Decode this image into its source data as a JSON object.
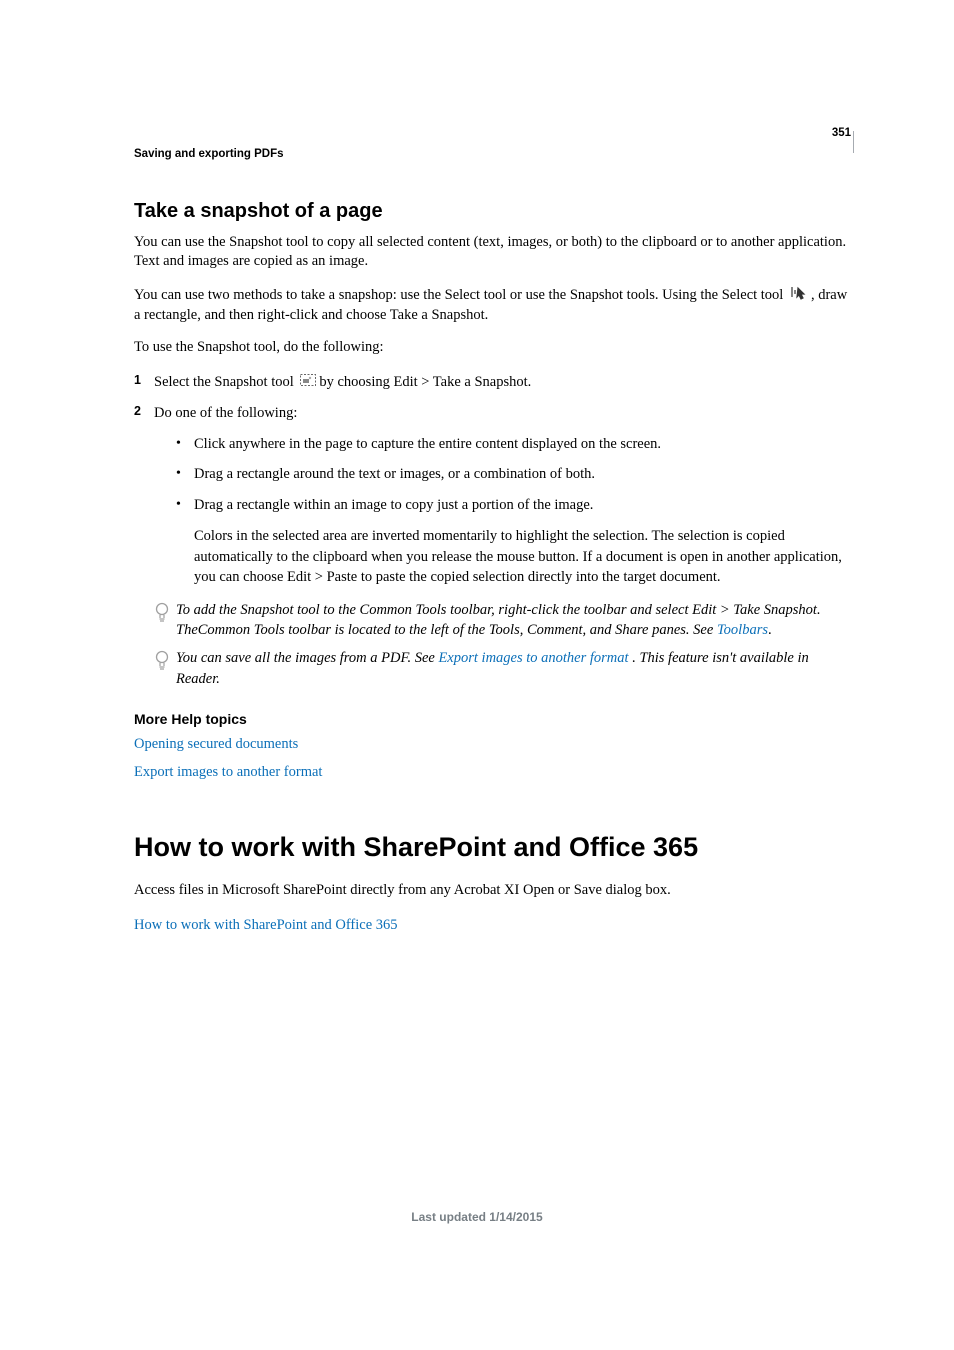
{
  "pageNumber": "351",
  "headerTitle": "Saving and exporting PDFs",
  "section1": {
    "heading": "Take a snapshot of a page",
    "p1": "You can use the Snapshot tool to copy all selected content (text, images, or both) to the clipboard or to another application. Text and images are copied as an image.",
    "p2a": "You can use two methods to take a snapshop: use the Select tool or use the Snapshot tools. Using the Select tool ",
    "p2b": ", draw a rectangle, and then right-click and choose Take a Snapshot.",
    "p3": "To use the Snapshot tool, do the following:",
    "step1_num": "1",
    "step1a": "Select the Snapshot tool ",
    "step1b": "by choosing Edit > Take a Snapshot.",
    "step2_num": "2",
    "step2": "Do one of the following:",
    "bullet1": "Click anywhere in the page to capture the entire content displayed on the screen.",
    "bullet2": "Drag a rectangle around the text or images, or a combination of both.",
    "bullet3": "Drag a rectangle within an image to copy just a portion of the image.",
    "sub_p": "Colors in the selected area are inverted momentarily to highlight the selection. The selection is copied automatically to the clipboard when you release the mouse button. If a document is open in another application, you can choose Edit > Paste to paste the copied selection directly into the target document.",
    "tip1a": "To add the Snapshot tool to the Common Tools toolbar, right-click the toolbar and select Edit > Take Snapshot. TheCommon Tools toolbar is located to the left of the Tools, Comment, and Share panes. See ",
    "tip1_link": "Toolbars",
    "tip1_period": ".",
    "tip2a": "You can save all the images from a PDF. See ",
    "tip2_link": "Export images to another format ",
    "tip2b": ". This feature isn't available in Reader."
  },
  "moreHelp": {
    "heading": "More Help topics",
    "link1": "Opening secured documents",
    "link2": "Export images to another format"
  },
  "section2": {
    "heading": "How to work with SharePoint and Office 365",
    "p1": "Access files in Microsoft SharePoint directly from any Acrobat XI Open or Save dialog box.",
    "link": "How to work with SharePoint and Office 365"
  },
  "footer": "Last updated 1/14/2015"
}
